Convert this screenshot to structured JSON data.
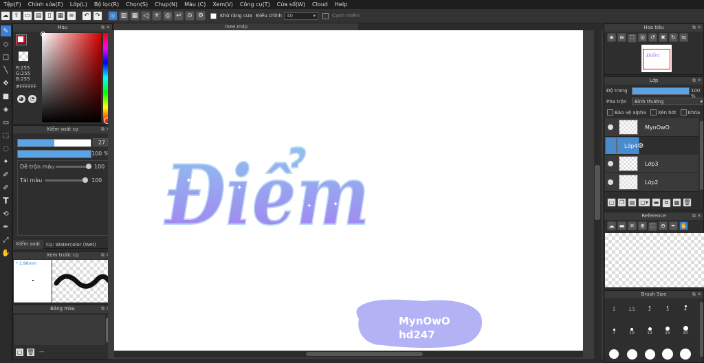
{
  "menu": [
    "Tệp(F)",
    "Chỉnh sửa(E)",
    "Lớp(L)",
    "Bộ lọc(R)",
    "Chọn(S)",
    "Chụp(N)",
    "Màu (C)",
    "Xem(V)",
    "Công cụ(T)",
    "Cửa sổ(W)",
    "Cloud",
    "Help"
  ],
  "toolbar": {
    "antialias_label": "Khử răng cưa",
    "adjust_label": "Điều chỉnh",
    "adjust_value": "40",
    "snap_label": "Cạnh miếm"
  },
  "canvas": {
    "tab_title": "mee.mdp",
    "artwork_word": "Điểm",
    "stamp_line1": "MynOwO",
    "stamp_line2": "hd247",
    "colors": {
      "word_top": "#8ec2ee",
      "word_bottom": "#a67cf2",
      "stamp": "#b2b2f5"
    }
  },
  "color_panel": {
    "title": "Màu",
    "r": "R:255",
    "g": "G:255",
    "b": "B:255",
    "hex": "#FFFFFF",
    "primary_color": "#ffffff",
    "secondary_color": "#c8102e"
  },
  "brush_control": {
    "title": "Kiểm soát cọ",
    "size_value": "27",
    "opacity_value": "100 %",
    "blend_label": "Dễ trộn màu",
    "blend_value": "100",
    "refill_label": "Tải màu",
    "refill_value": "100",
    "tab_label": "Kiểm soát cọ",
    "brush_name": "Cọ: Watercolor (Wet)"
  },
  "brush_preview": {
    "title": "Xem trước cọ",
    "size_text": "* 1.96mm"
  },
  "palette": {
    "title": "Bảng màu",
    "footer": "---"
  },
  "navigator": {
    "title": "Hoa tiêu",
    "thumb_word": "Điểm"
  },
  "layers_panel": {
    "title": "Lớp",
    "opacity_label": "Độ trong",
    "opacity_value": "100 %",
    "blend_label": "Pha trộn",
    "blend_value": "Bình thường",
    "protect_alpha": "Bảo vệ alpha",
    "clip": "Xén bớt",
    "lock": "Khóa",
    "layers": [
      {
        "name": "MynOwO"
      },
      {
        "name": "Lớp4"
      },
      {
        "name": "Lớp3"
      },
      {
        "name": "Lớp2"
      }
    ]
  },
  "reference": {
    "title": "Reference"
  },
  "brush_size": {
    "title": "Brush Size",
    "row1": [
      "1",
      "1.5",
      "2",
      "3",
      "4"
    ],
    "row2": [
      "7",
      "10",
      "12",
      "15",
      "20"
    ]
  }
}
